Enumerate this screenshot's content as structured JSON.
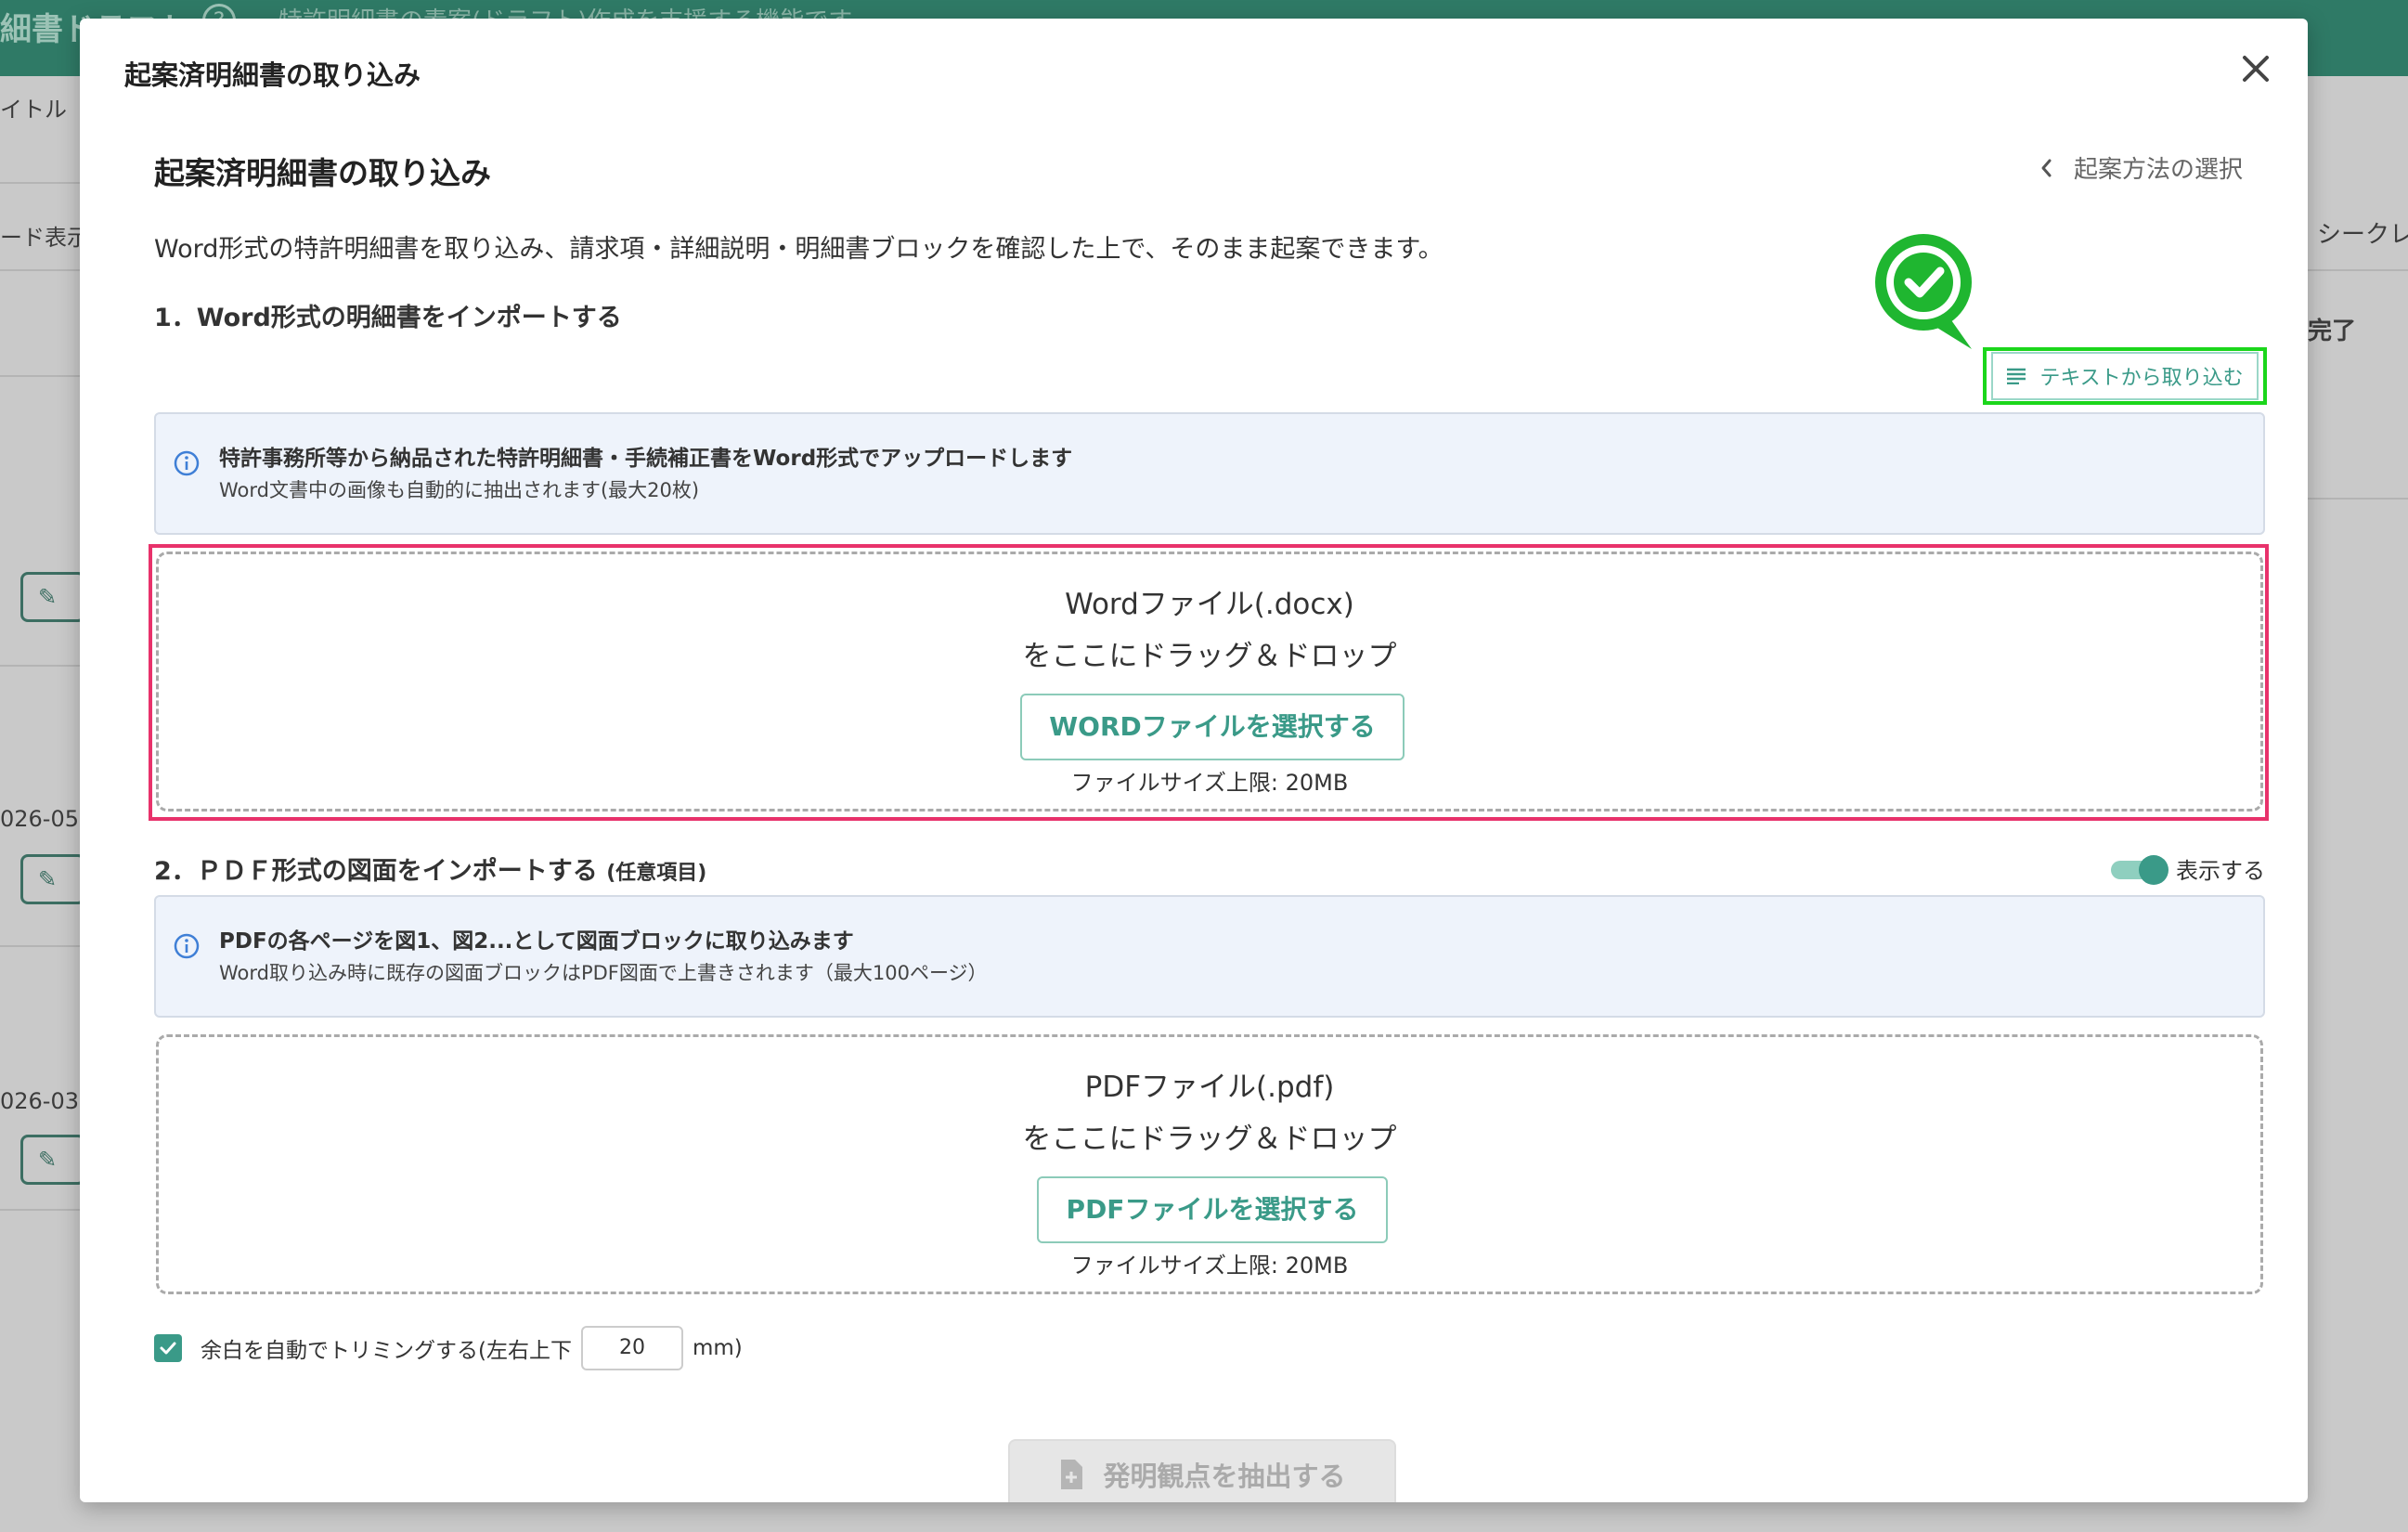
{
  "background": {
    "header_title": "細書ドラフト",
    "help_label": "?",
    "header_desc": "特許明細書の素案(ドラフト)作成を支援する機能です",
    "left_texts": [
      "イトル",
      "ード表示",
      "026-05-",
      "026-03-"
    ],
    "right_texts": [
      "シークレ",
      "完了"
    ]
  },
  "modal": {
    "title": "起案済明細書の取り込み",
    "section_title": "起案済明細書の取り込み",
    "back_link": "起案方法の選択",
    "description": "Word形式の特許明細書を取り込み、請求項・詳細説明・明細書ブロックを確認した上で、そのまま起案できます。",
    "text_import_label": "テキストから取り込む",
    "step1": {
      "title": "1．Word形式の明細書をインポートする",
      "info_main": "特許事務所等から納品された特許明細書・手続補正書をWord形式でアップロードします",
      "info_sub": "Word文書中の画像も自動的に抽出されます(最大20枚)",
      "drop_line1": "Wordファイル(.docx)",
      "drop_line2": "をここにドラッグ＆ドロップ",
      "button": "WORDファイルを選択する",
      "size_limit": "ファイルサイズ上限: 20MB"
    },
    "step2": {
      "title": "2．ＰＤＦ形式の図面をインポートする",
      "optional": "(任意項目)",
      "toggle_label": "表示する",
      "toggle_on": true,
      "info_main": "PDFの各ページを図1、図2...として図面ブロックに取り込みます",
      "info_sub": "Word取り込み時に既存の図面ブロックはPDF図面で上書きされます（最大100ページ）",
      "drop_line1": "PDFファイル(.pdf)",
      "drop_line2": "をここにドラッグ＆ドロップ",
      "button": "PDFファイルを選択する",
      "size_limit": "ファイルサイズ上限: 20MB"
    },
    "trim": {
      "checked": true,
      "label": "余白を自動でトリミングする(左右上下",
      "value": "20",
      "unit": "mm)"
    },
    "extract_button": "発明観点を抽出する"
  },
  "colors": {
    "accent": "#3a9a88",
    "header_bg": "#2f7a66",
    "highlight_red": "#e8326b",
    "highlight_green": "#1bd61b",
    "info_bg": "#eef3fb"
  },
  "icons": [
    "close-icon",
    "chevron-left-icon",
    "lines-icon",
    "info-icon",
    "check-icon",
    "document-plus-icon",
    "check-badge-icon"
  ]
}
